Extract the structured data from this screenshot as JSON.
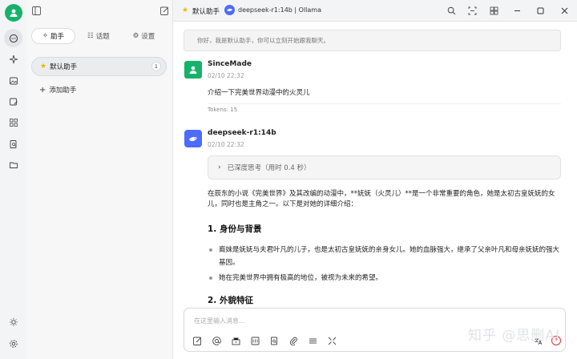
{
  "window": {
    "assistant_name": "默认助手",
    "model_label": "deepseek-r1:14b | Ollama"
  },
  "sidebar": {
    "tabs": [
      {
        "label": "助手",
        "icon": "sparkle-icon"
      },
      {
        "label": "话题",
        "icon": "list-icon"
      },
      {
        "label": "设置",
        "icon": "gear-icon"
      }
    ],
    "assistant_item": {
      "label": "默认助手",
      "count": "1"
    },
    "add_label": "添加助手"
  },
  "chat": {
    "greeting": "你好，我是默认助手，你可以立刻开始跟我聊天。",
    "user": {
      "name": "SinceMade",
      "time": "02/10 22:32",
      "text": "介绍一下完美世界动漫中的火灵儿",
      "tokens": "Tokens: 15"
    },
    "bot": {
      "name": "deepseek-r1:14b",
      "time": "02/10 22:32",
      "think_label": "已深度思考（用时 0.4 秒）",
      "intro": "在辰东的小说《完美世界》及其改编的动漫中，**妩妩（火灵儿）**是一个非常重要的角色，她是太初古皇妩妩的女儿，同时也是主角之一。以下是对她的详细介绍：",
      "h1": "1. 身份与背景",
      "b1": "裔妹是妩妩与夫君叶凡的儿子，也是太初古皇妩妩的亲身女儿。她的血脉强大，继承了父亲叶凡和母亲妩妩的强大基因。",
      "b2": "她在完美世界中拥有极高的地位，被视为未来的希望。",
      "h2": "2. 外貌特征"
    }
  },
  "input": {
    "placeholder": "在这里输入消息..."
  },
  "watermark": "知乎 @思删AI",
  "colors": {
    "accent_green": "#17b26a",
    "model_blue": "#4d6bfe",
    "star": "#f5b400",
    "send_red": "#e5484d"
  }
}
